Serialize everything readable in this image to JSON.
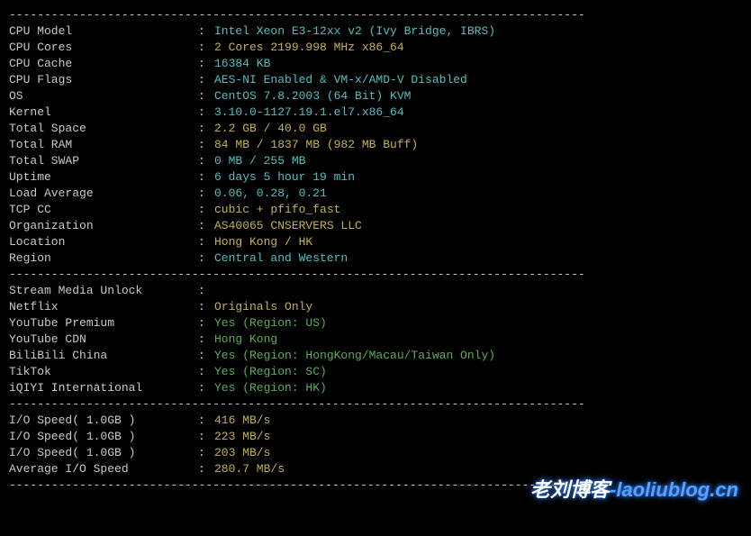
{
  "dash_line": "----------------------------------------------------------------------------------",
  "system": [
    {
      "label": "CPU Model",
      "value": "Intel Xeon E3-12xx v2 (Ivy Bridge, IBRS)",
      "cls": "cyan"
    },
    {
      "label": "CPU Cores",
      "value": "2 Cores 2199.998 MHz x86_64",
      "cls": "yellow"
    },
    {
      "label": "CPU Cache",
      "value": "16384 KB",
      "cls": "cyan"
    },
    {
      "label": "CPU Flags",
      "value": "AES-NI Enabled & VM-x/AMD-V Disabled",
      "cls": "cyan"
    },
    {
      "label": "OS",
      "value": "CentOS 7.8.2003 (64 Bit) KVM",
      "cls": "cyan"
    },
    {
      "label": "Kernel",
      "value": "3.10.0-1127.19.1.el7.x86_64",
      "cls": "cyan"
    },
    {
      "label": "Total Space",
      "value": "2.2 GB / 40.0 GB",
      "cls": "yellow"
    },
    {
      "label": "Total RAM",
      "value": "84 MB / 1837 MB (982 MB Buff)",
      "cls": "yellow"
    },
    {
      "label": "Total SWAP",
      "value": "0 MB / 255 MB",
      "cls": "cyan"
    },
    {
      "label": "Uptime",
      "value": "6 days 5 hour 19 min",
      "cls": "cyan"
    },
    {
      "label": "Load Average",
      "value": "0.06, 0.28, 0.21",
      "cls": "cyan"
    },
    {
      "label": "TCP CC",
      "value": "cubic + pfifo_fast",
      "cls": "yellow"
    },
    {
      "label": "Organization",
      "value": "AS40065 CNSERVERS LLC",
      "cls": "yellow"
    },
    {
      "label": "Location",
      "value": "Hong Kong / HK",
      "cls": "yellow"
    },
    {
      "label": "Region",
      "value": "Central and Western",
      "cls": "cyan"
    }
  ],
  "stream_header": {
    "label": "Stream Media Unlock",
    "value": "",
    "cls": "gray"
  },
  "stream": [
    {
      "label": "Netflix",
      "value": "Originals Only",
      "cls": "yellow"
    },
    {
      "label": "YouTube Premium",
      "value": "Yes (Region: US)",
      "cls": "green"
    },
    {
      "label": "YouTube CDN",
      "value": "Hong Kong",
      "cls": "green"
    },
    {
      "label": "BiliBili China",
      "value": "Yes (Region: HongKong/Macau/Taiwan Only)",
      "cls": "green"
    },
    {
      "label": "TikTok",
      "value": "Yes (Region: SC)",
      "cls": "green"
    },
    {
      "label": "iQIYI International",
      "value": "Yes (Region: HK)",
      "cls": "green"
    }
  ],
  "io": [
    {
      "label": "I/O Speed( 1.0GB )",
      "value": "416 MB/s",
      "cls": "yellow"
    },
    {
      "label": "I/O Speed( 1.0GB )",
      "value": "223 MB/s",
      "cls": "yellow"
    },
    {
      "label": "I/O Speed( 1.0GB )",
      "value": "203 MB/s",
      "cls": "yellow"
    },
    {
      "label": "Average I/O Speed",
      "value": "280.7 MB/s",
      "cls": "yellow"
    }
  ],
  "watermark": {
    "zh": "老刘博客",
    "en": "-laoliublog.cn"
  }
}
